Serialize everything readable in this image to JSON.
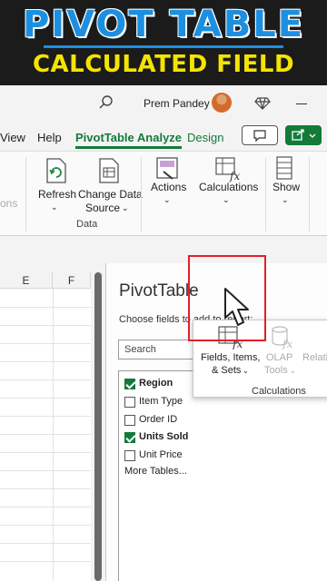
{
  "banner": {
    "title": "PIVOT TABLE",
    "subtitle": "CALCULATED FIELD"
  },
  "titlebar": {
    "user_name": "Prem Pandey"
  },
  "tabs": [
    {
      "label": "View"
    },
    {
      "label": "Help"
    },
    {
      "label": "PivotTable Analyze"
    },
    {
      "label": "Design"
    }
  ],
  "ribbon": {
    "left_cut": "ons",
    "refresh": "Refresh",
    "change_data_source_1": "Change Data",
    "change_data_source_2": "Source",
    "data_group": "Data",
    "actions": "Actions",
    "calculations": "Calculations",
    "show": "Show"
  },
  "popup": {
    "fields_items_1": "Fields, Items,",
    "fields_items_2": "& Sets",
    "olap_1": "OLAP",
    "olap_2": "Tools",
    "relationships": "Relati",
    "group_label": "Calculations"
  },
  "sheet": {
    "columns": [
      "E",
      "F"
    ]
  },
  "pane": {
    "title": "PivotTable",
    "subtitle": "Choose fields to add to report:",
    "search_placeholder": "Search",
    "fields": [
      {
        "label": "Region",
        "checked": true
      },
      {
        "label": "Item Type",
        "checked": false
      },
      {
        "label": "Order ID",
        "checked": false
      },
      {
        "label": "Units Sold",
        "checked": true
      },
      {
        "label": "Unit Price",
        "checked": false
      }
    ],
    "more_tables": "More Tables..."
  },
  "colors": {
    "accent_green": "#137a3a",
    "title_blue": "#1d8fe0",
    "subtitle_yellow": "#f5e400",
    "highlight_red": "#e0202a"
  }
}
